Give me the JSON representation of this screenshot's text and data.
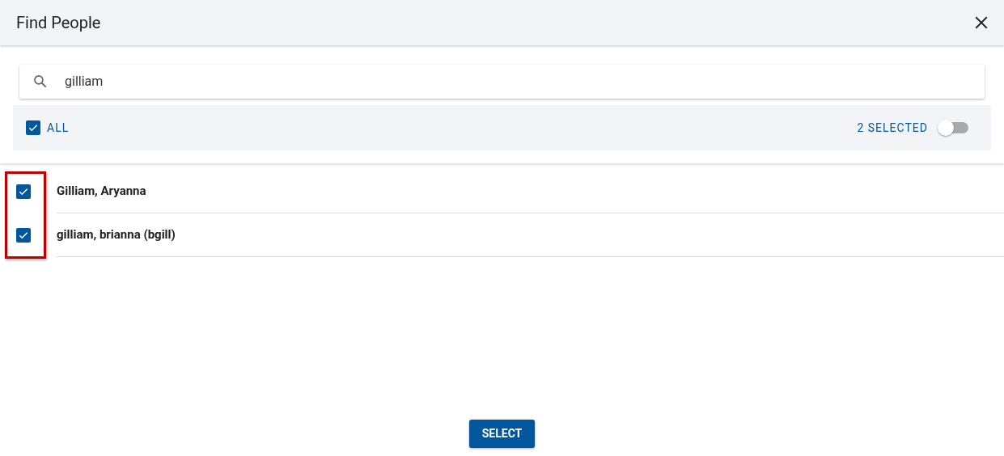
{
  "dialog": {
    "title": "Find People"
  },
  "search": {
    "value": "gilliam"
  },
  "filter_bar": {
    "all_label": "ALL",
    "all_checked": true,
    "selected_count": "2 SELECTED",
    "toggle_on": false
  },
  "people": [
    {
      "name": "Gilliam, Aryanna",
      "checked": true
    },
    {
      "name": "gilliam, brianna (bgill)",
      "checked": true
    }
  ],
  "buttons": [
    "SELECT"
  ]
}
